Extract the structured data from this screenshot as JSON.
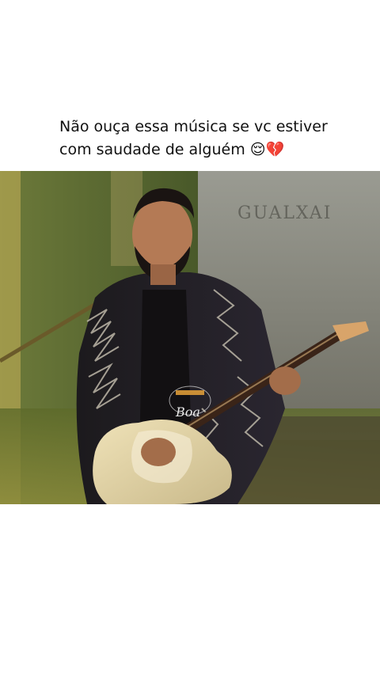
{
  "post": {
    "caption_line1": "Não ouça essa música se vc estiver",
    "caption_line2": "com saudade de alguém 😌💔"
  },
  "video": {
    "watermark_text": "Boa",
    "backdrop_sign": "GUALXAI"
  }
}
